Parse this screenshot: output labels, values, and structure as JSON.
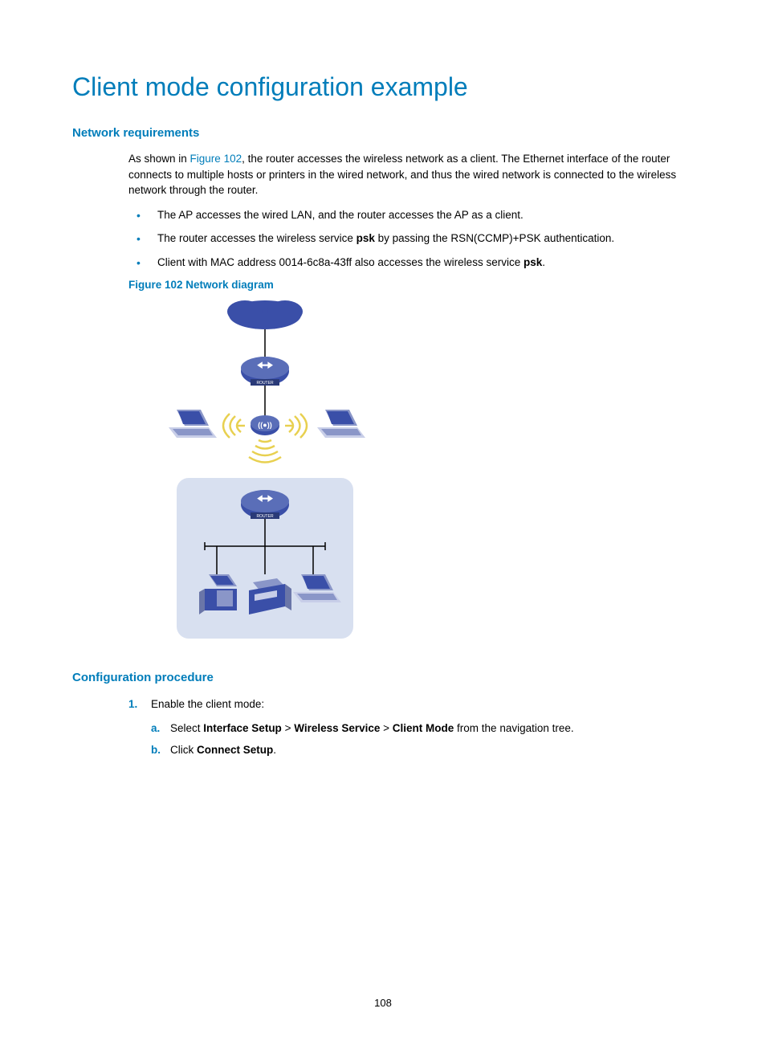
{
  "title": "Client mode configuration example",
  "section1": {
    "heading": "Network requirements",
    "intro_prefix": "As shown in ",
    "intro_link": "Figure 102",
    "intro_suffix": ", the router accesses the wireless network as a client. The Ethernet interface of the router connects to multiple hosts or printers in the wired network, and thus the wired network is connected to the wireless network through the router.",
    "bullets": {
      "b1": "The AP accesses the wired LAN, and the router accesses the AP as a client.",
      "b2_pre": "The router accesses the wireless service ",
      "b2_bold": "psk",
      "b2_post": " by passing the RSN(CCMP)+PSK authentication.",
      "b3_pre": "Client with MAC address 0014-6c8a-43ff also accesses the wireless service ",
      "b3_bold": "psk",
      "b3_post": "."
    },
    "figure_caption": "Figure 102 Network diagram"
  },
  "diagram_labels": {
    "router_top": "ROUTER",
    "router_bottom": "ROUTER"
  },
  "section2": {
    "heading": "Configuration procedure",
    "step1_num": "1.",
    "step1_text": "Enable the client mode:",
    "sub_a_letter": "a.",
    "sub_a_pre": "Select ",
    "sub_a_b1": "Interface Setup",
    "sub_a_gt1": " > ",
    "sub_a_b2": "Wireless Service",
    "sub_a_gt2": " > ",
    "sub_a_b3": "Client Mode",
    "sub_a_post": " from the navigation tree.",
    "sub_b_letter": "b.",
    "sub_b_pre": "Click ",
    "sub_b_bold": "Connect Setup",
    "sub_b_post": "."
  },
  "page_number": "108"
}
